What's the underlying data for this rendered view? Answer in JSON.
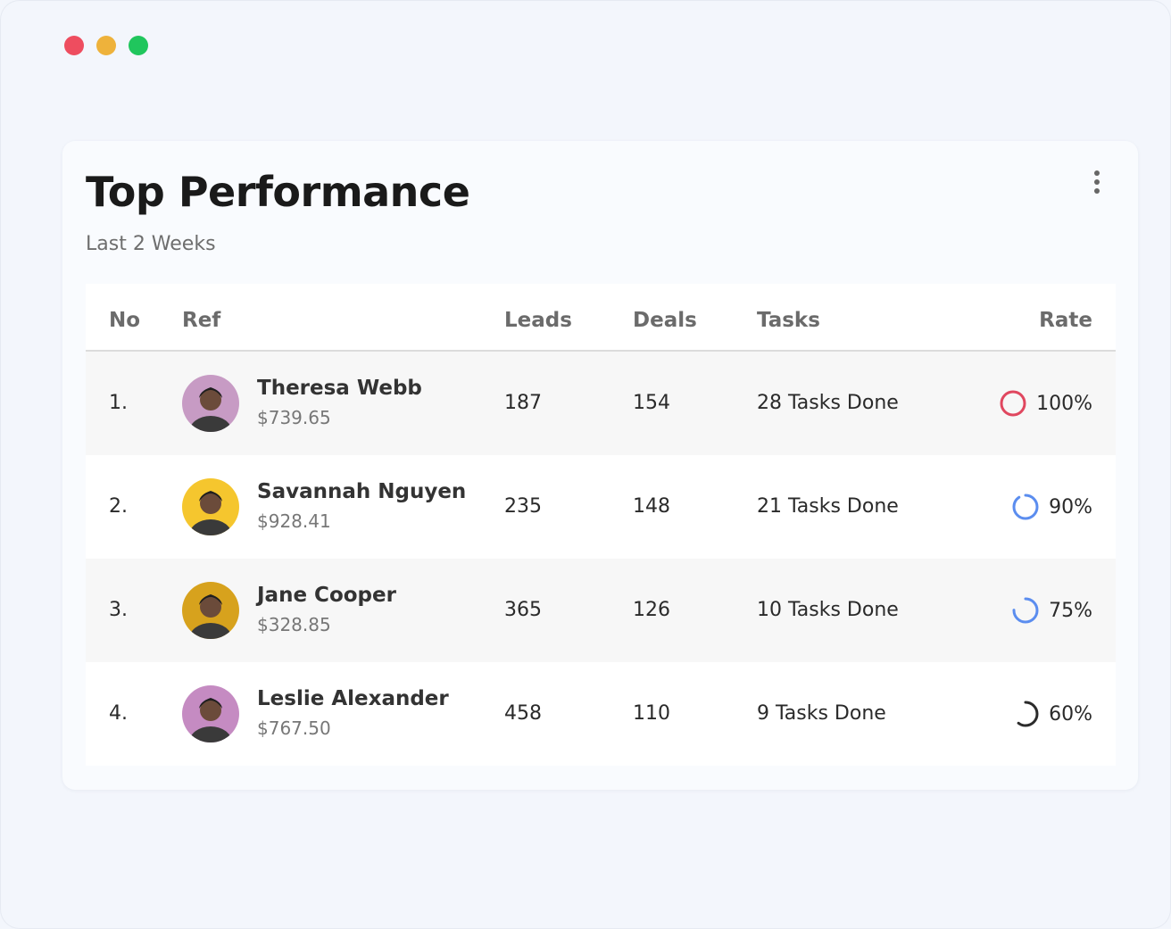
{
  "window": {
    "controls": [
      {
        "name": "close",
        "color": "#ee4d5f"
      },
      {
        "name": "minimize",
        "color": "#eeb23b"
      },
      {
        "name": "maximize",
        "color": "#20c65d"
      }
    ]
  },
  "card": {
    "title": "Top Performance",
    "subtitle": "Last 2 Weeks",
    "menu_icon": "more-vertical-icon"
  },
  "table": {
    "headers": {
      "no": "No",
      "ref": "Ref",
      "leads": "Leads",
      "deals": "Deals",
      "tasks": "Tasks",
      "rate": "Rate"
    },
    "rows": [
      {
        "no": "1.",
        "name": "Theresa Webb",
        "amount": "$739.65",
        "leads": "187",
        "deals": "154",
        "tasks": "28 Tasks Done",
        "rate": "100%",
        "rate_value": 1.0,
        "rate_color": "#e0475f",
        "avatar_bg": "#c79bc4"
      },
      {
        "no": "2.",
        "name": "Savannah Nguyen",
        "amount": "$928.41",
        "leads": "235",
        "deals": "148",
        "tasks": "21 Tasks Done",
        "rate": "90%",
        "rate_value": 0.9,
        "rate_color": "#5b8def",
        "avatar_bg": "#f5c62e"
      },
      {
        "no": "3.",
        "name": "Jane Cooper",
        "amount": "$328.85",
        "leads": "365",
        "deals": "126",
        "tasks": "10 Tasks Done",
        "rate": "75%",
        "rate_value": 0.75,
        "rate_color": "#5b8def",
        "avatar_bg": "#d7a21d"
      },
      {
        "no": "4.",
        "name": "Leslie Alexander",
        "amount": "$767.50",
        "leads": "458",
        "deals": "110",
        "tasks": "9 Tasks Done",
        "rate": "60%",
        "rate_value": 0.6,
        "rate_color": "#2b2b2b",
        "avatar_bg": "#c58bc2"
      }
    ]
  }
}
